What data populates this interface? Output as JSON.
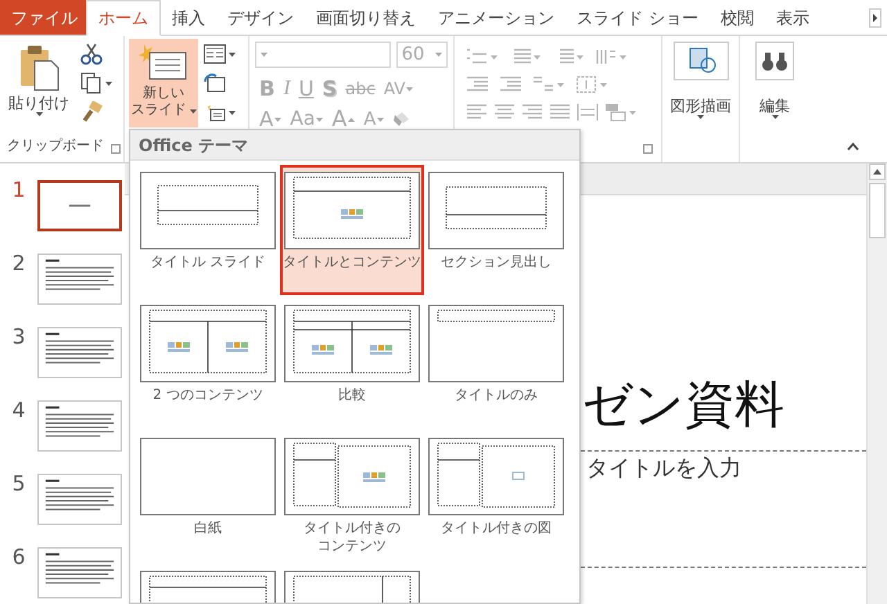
{
  "tabs": [
    {
      "label": "ファイル",
      "kind": "file",
      "selected": false
    },
    {
      "label": "ホーム",
      "kind": "tab",
      "selected": true
    },
    {
      "label": "挿入",
      "kind": "tab",
      "selected": false
    },
    {
      "label": "デザイン",
      "kind": "tab",
      "selected": false
    },
    {
      "label": "画面切り替え",
      "kind": "tab",
      "selected": false
    },
    {
      "label": "アニメーション",
      "kind": "tab",
      "selected": false
    },
    {
      "label": "スライド ショー",
      "kind": "tab",
      "selected": false
    },
    {
      "label": "校閲",
      "kind": "tab",
      "selected": false
    },
    {
      "label": "表示",
      "kind": "tab",
      "selected": false
    }
  ],
  "ribbon": {
    "clipboard": {
      "paste_label": "貼り付け",
      "group_label": "クリップボード"
    },
    "slides": {
      "new_slide_lines": [
        "新しい",
        "スライド"
      ],
      "pressed": true
    },
    "font": {
      "disabled": true,
      "size": "60",
      "row_1": [
        {
          "text": "B",
          "kind": "bold"
        },
        {
          "text": "I",
          "kind": "italic"
        },
        {
          "text": "U",
          "kind": "underline"
        },
        {
          "text": "S",
          "kind": "shadow"
        },
        {
          "text": "abc",
          "kind": "strike"
        },
        {
          "text": "AV",
          "kind": "spacing"
        }
      ],
      "row_2": [
        {
          "text": "A",
          "kind": "color"
        },
        {
          "text": "Aa",
          "kind": "case"
        },
        {
          "text": "A",
          "kind": "grow"
        },
        {
          "text": "A",
          "kind": "shrink"
        }
      ]
    },
    "paragraph": {
      "disabled": true
    },
    "drawing": {
      "label": "図形描画"
    },
    "editing": {
      "label": "編集"
    }
  },
  "slide_panel": [
    {
      "number": "1",
      "selected": true,
      "kind": "title"
    },
    {
      "number": "2",
      "selected": false,
      "kind": "text"
    },
    {
      "number": "3",
      "selected": false,
      "kind": "text"
    },
    {
      "number": "4",
      "selected": false,
      "kind": "text"
    },
    {
      "number": "5",
      "selected": false,
      "kind": "text"
    },
    {
      "number": "6",
      "selected": false,
      "kind": "text"
    }
  ],
  "layout_gallery": {
    "title": "Office テーマ",
    "layouts": [
      {
        "label": "タイトル スライド",
        "kind": "title_slide",
        "selected": false
      },
      {
        "label": "タイトルとコンテンツ",
        "kind": "title_content",
        "selected": true
      },
      {
        "label": "セクション見出し",
        "kind": "section",
        "selected": false
      },
      {
        "label": "2 つのコンテンツ",
        "kind": "two_content",
        "selected": false
      },
      {
        "label": "比較",
        "kind": "comparison",
        "selected": false
      },
      {
        "label": "タイトルのみ",
        "kind": "title_only",
        "selected": false
      },
      {
        "label": "白紙",
        "kind": "blank",
        "selected": false
      },
      {
        "label": "タイトル付きのコンテンツ",
        "kind": "content_caption",
        "selected": false
      },
      {
        "label": "タイトル付きの図",
        "kind": "picture_caption",
        "selected": false
      },
      {
        "kind": "title_vertical",
        "selected": false
      },
      {
        "kind": "vertical_title",
        "selected": false
      }
    ]
  },
  "slide": {
    "title": "ゼン資料",
    "subtitle": "タイトルを入力"
  }
}
